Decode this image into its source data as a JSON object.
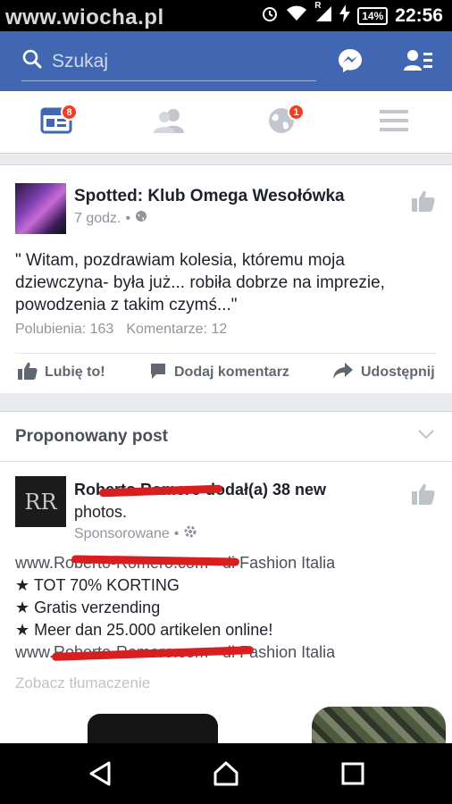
{
  "status_bar": {
    "watermark": "www.wiocha.pl",
    "network_label": "R",
    "battery": "14%",
    "time": "22:56"
  },
  "app_bar": {
    "search_placeholder": "Szukaj",
    "icons": [
      "search-icon",
      "messenger-icon",
      "contacts-icon"
    ],
    "color": "#4267b2"
  },
  "tabs": [
    {
      "icon": "news-feed-icon",
      "badge": "8",
      "active": true
    },
    {
      "icon": "friends-icon",
      "badge": ""
    },
    {
      "icon": "notifications-globe-icon",
      "badge": "1"
    },
    {
      "icon": "menu-icon",
      "badge": ""
    }
  ],
  "post1": {
    "page_name": "Spotted: Klub Omega Wesołówka",
    "time": "7 godz.",
    "text": "\" Witam, pozdrawiam kolesia, któremu moja dziewczyna- była już... robiła dobrze na imprezie, powodzenia z takim czymś...\"",
    "likes": "Polubienia: 163",
    "comments": "Komentarze: 12",
    "actions": {
      "like": "Lubię to!",
      "comment": "Dodaj komentarz",
      "share": "Udostępnij"
    }
  },
  "suggested": {
    "title": "Proponowany post",
    "logo_text": "RR",
    "author_line_1": "Roberto Romero dodał(a) 38 new",
    "author_line_2": "photos.",
    "sponsored": "Sponsorowane",
    "lines": [
      "www.Roberto-Romero.com - di Fashion Italia",
      "★ TOT 70% KORTING",
      "★ Gratis verzending",
      "★ Meer dan 25.000 artikelen online!",
      "www.Roberto-Romero.com - di Fashion Italia"
    ],
    "translate": "Zobacz tłumaczenie"
  },
  "nav": {
    "icons": [
      "back-icon",
      "home-icon",
      "recents-icon"
    ]
  }
}
